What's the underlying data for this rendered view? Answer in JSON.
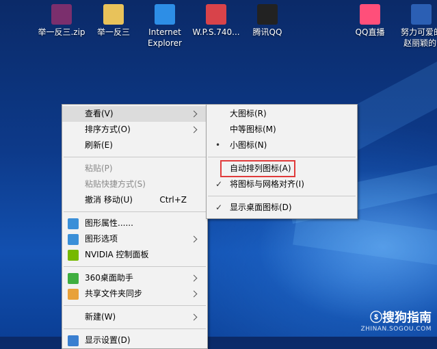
{
  "desktop_icons": [
    {
      "label": "举一反三.zip",
      "icon": "winrar-archive-icon",
      "color": "#7b2f6d"
    },
    {
      "label": "举一反三",
      "icon": "folder-icon",
      "color": "#e8c25a"
    },
    {
      "label": "Internet\nExplorer",
      "icon": "internet-explorer-icon",
      "color": "#2d8ee6"
    },
    {
      "label": "W.P.S.740...",
      "icon": "wps-icon",
      "color": "#d8434a"
    },
    {
      "label": "腾讯QQ",
      "icon": "qq-penguin-icon",
      "color": "#222222"
    },
    {
      "label": "QQ直播",
      "icon": "qq-live-icon",
      "color": "#ff4f7a"
    },
    {
      "label": "努力可爱的\n赵丽颖的.",
      "icon": "word-document-icon",
      "color": "#2b5fb4"
    }
  ],
  "context_menu": {
    "items": [
      {
        "label": "查看(V)",
        "has_submenu": true,
        "highlighted": true
      },
      {
        "label": "排序方式(O)",
        "has_submenu": true
      },
      {
        "label": "刷新(E)"
      },
      {
        "separator": true
      },
      {
        "label": "粘贴(P)",
        "disabled": true
      },
      {
        "label": "粘贴快捷方式(S)",
        "disabled": true
      },
      {
        "label": "撤消 移动(U)",
        "shortcut": "Ctrl+Z"
      },
      {
        "separator": true
      },
      {
        "label": "图形属性......",
        "icon": "intel-graphics-icon"
      },
      {
        "label": "图形选项",
        "icon": "intel-graphics-icon",
        "has_submenu": true
      },
      {
        "label": "NVIDIA 控制面板",
        "icon": "nvidia-icon"
      },
      {
        "separator": true
      },
      {
        "label": "360桌面助手",
        "icon": "360-desktop-icon",
        "has_submenu": true
      },
      {
        "label": "共享文件夹同步",
        "icon": "share-sync-icon",
        "has_submenu": true
      },
      {
        "separator": true
      },
      {
        "label": "新建(W)",
        "has_submenu": true
      },
      {
        "separator": true
      },
      {
        "label": "显示设置(D)",
        "icon": "display-settings-icon"
      }
    ]
  },
  "view_submenu": {
    "items": [
      {
        "label": "大图标(R)"
      },
      {
        "label": "中等图标(M)"
      },
      {
        "label": "小图标(N)",
        "mark": "•"
      },
      {
        "separator": true
      },
      {
        "label": "自动排列图标(A)",
        "boxed": true
      },
      {
        "label": "将图标与网格对齐(I)",
        "mark": "✓"
      },
      {
        "separator": true
      },
      {
        "label": "显示桌面图标(D)",
        "mark": "✓"
      }
    ]
  },
  "watermark": {
    "logo": "ⓢ搜狗指南",
    "url": "ZHINAN.SOGOU.COM"
  },
  "colors": {
    "highlight_box": "#e03a3a",
    "menu_bg": "#f2f2f2",
    "desktop": "#0d3a8a"
  }
}
